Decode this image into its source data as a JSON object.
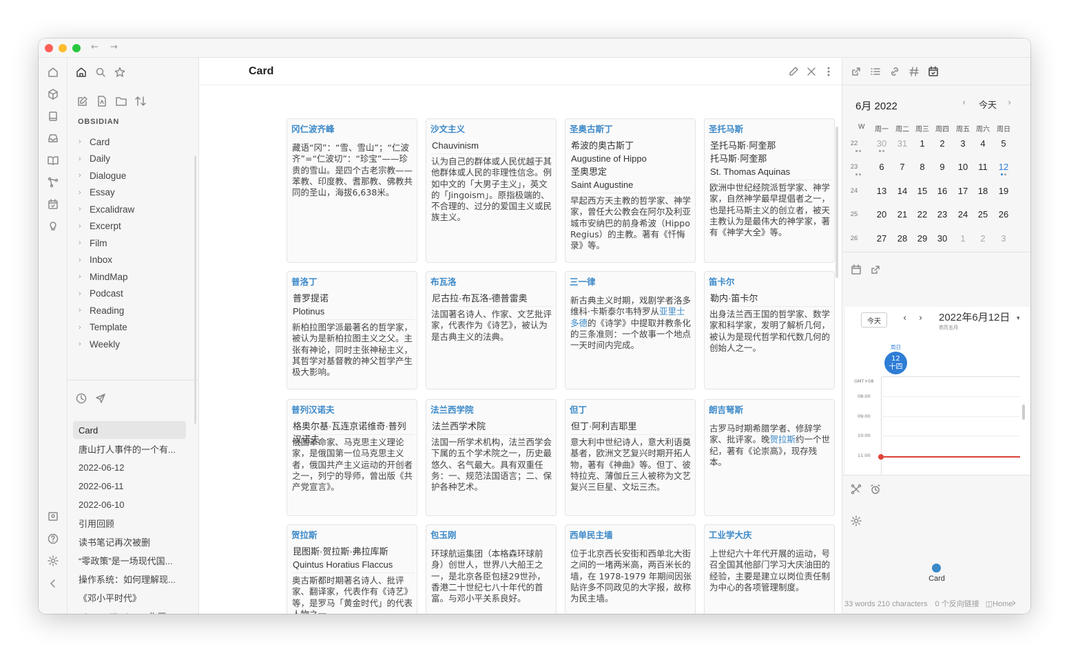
{
  "window": {
    "nav_back": "←",
    "nav_forward": "→"
  },
  "sidebar": {
    "vault_name": "OBSIDIAN",
    "folders": [
      "Card",
      "Daily",
      "Dialogue",
      "Essay",
      "Excalidraw",
      "Excerpt",
      "Film",
      "Inbox",
      "MindMap",
      "Podcast",
      "Reading",
      "Template",
      "Weekly"
    ],
    "recent": [
      "Card",
      "唐山打人事件的一个有...",
      "2022-06-12",
      "2022-06-11",
      "2022-06-10",
      "引用回顾",
      "读书笔记再次被删",
      "“零政策”是一场现代国...",
      "操作系统：如何理解现...",
      "《邓小平时代》",
      "Disco Diffusion AI作画..."
    ]
  },
  "main": {
    "title": "Card",
    "cards": [
      {
        "title": "冈仁波齐峰",
        "sub": [],
        "desc": "藏语“冈”：“雪、雪山”；“仁波齐”=“仁波切”：“珍宝”——珍贵的雪山。是四个古老宗教——苯教、印度教、耆那教、佛教共同的圣山，海拔6,638米。"
      },
      {
        "title": "沙文主义",
        "sub": [
          "Chauvinism"
        ],
        "desc": "认为自己的群体或人民优越于其他群体或人民的非理性信念。例如中文的「大男子主义」，英文的「Jingoism」。原指极端的、不合理的、过分的爱国主义或民族主义。"
      },
      {
        "title": "圣奥古斯丁",
        "sub": [
          "希波的奥古斯丁",
          "Augustine of Hippo",
          "圣奥思定",
          "Saint Augustine"
        ],
        "desc": "早起西方天主教的哲学家、神学家，曾任大公教会在阿尔及利亚城市安纳巴的前身希波（Hippo Regius）的主教。著有《忏悔录》等。"
      },
      {
        "title": "圣托马斯",
        "sub": [
          "圣托马斯·阿奎那",
          "托马斯·阿奎那",
          "St. Thomas Aquinas"
        ],
        "desc": "欧洲中世纪经院派哲学家、神学家，自然神学最早提倡者之一，也是托马斯主义的创立者，被天主教认为是最伟大的神学家，著有《神学大全》等。"
      },
      {
        "title": "普洛丁",
        "sub": [
          "普罗提诺",
          "Plotinus"
        ],
        "desc": "新柏拉图学派最著名的哲学家，被认为是新柏拉图主义之父。主张有神论，同时主张神秘主义，其哲学对基督教的神父哲学产生极大影响。"
      },
      {
        "title": "布瓦洛",
        "sub": [
          "尼古拉·布瓦洛-德普雷奥"
        ],
        "desc": "法国著名诗人、作家、文艺批评家，代表作为《诗艺》，被认为是古典主义的法典。"
      },
      {
        "title": "三一律",
        "sub": [],
        "desc_pre": "新古典主义时期，戏剧学者洛多维科·卡斯泰尔韦特罗从",
        "desc_link": "亚里士多德",
        "desc_post": "的《诗学》中提取并教条化的三条准则：一个故事一个地点一天时间内完成。"
      },
      {
        "title": "笛卡尔",
        "sub": [
          "勒内·笛卡尔"
        ],
        "desc": "出身法兰西王国的哲学家、数学家和科学家，发明了解析几何，被认为是现代哲学和代数几何的创始人之一。"
      },
      {
        "title": "普列汉诺夫",
        "sub": [
          "格奥尔基·瓦连京诺维奇·普列汉诺夫"
        ],
        "desc": "俄国革命家、马克思主义理论家，是俄国第一位马克思主义者，俄国共产主义运动的开创者之一，列宁的导师，曾出版《共产党宣言》。"
      },
      {
        "title": "法兰西学院",
        "sub": [
          "法兰西学术院"
        ],
        "desc": "法国一所学术机构，法兰西学会下属的五个学术院之一，历史最悠久、名气最大。具有双重任务：一、规范法国语言；二、保护各种艺术。"
      },
      {
        "title": "但丁",
        "sub": [
          "但丁·阿利吉耶里"
        ],
        "desc": "意大利中世纪诗人，意大利语奠基者，欧洲文艺复兴时期开拓人物，著有《神曲》等。但丁、彼特拉克、薄伽丘三人被称为文艺复兴三巨星、文坛三杰。"
      },
      {
        "title": "朗吉弩斯",
        "sub": [],
        "desc_pre": "古罗马时期希腊学者、修辞学家、批评家。晚",
        "desc_link": "贺拉斯",
        "desc_post": "约一个世纪，著有《论崇高》，现存残本。"
      },
      {
        "title": "贺拉斯",
        "sub": [
          "昆图斯·贺拉斯·弗拉库斯",
          "Quintus Horatius Flaccus"
        ],
        "desc": "奥古斯都时期著名诗人、批评家、翻译家，代表作有《诗艺》等，是罗马「黄金时代」的代表人物之一。"
      },
      {
        "title": "包玉刚",
        "sub": [],
        "desc": "环球航运集团（本格森环球前身）创世人，世界八大船王之一，是北京各臣包拯29世孙，香港二十世纪七八十年代的首富。与邓小平关系良好。"
      },
      {
        "title": "西单民主墙",
        "sub": [],
        "desc": "位于北京西长安街和西单北大街之间的一堵两米高，两百米长的墙，在 1978-1979 年期间因张贴许多不同政见的大字报，故称为民主墙。"
      },
      {
        "title": "工业学大庆",
        "sub": [],
        "desc": "上世纪六十年代开展的运动，号召全国其他部门学习大庆油田的经验，主要是建立以岗位责任制为中心的各项管理制度。"
      }
    ]
  },
  "calendar": {
    "month_title": "6月 2022",
    "today_label": "今天",
    "week_header": [
      "W",
      "周一",
      "周二",
      "周三",
      "周四",
      "周五",
      "周六",
      "周日"
    ],
    "weeks": [
      {
        "wk": "22",
        "days": [
          "30",
          "31",
          "1",
          "2",
          "3",
          "4",
          "5"
        ]
      },
      {
        "wk": "23",
        "days": [
          "6",
          "7",
          "8",
          "9",
          "10",
          "11",
          "12"
        ]
      },
      {
        "wk": "24",
        "days": [
          "13",
          "14",
          "15",
          "16",
          "17",
          "18",
          "19"
        ]
      },
      {
        "wk": "25",
        "days": [
          "20",
          "21",
          "22",
          "23",
          "24",
          "25",
          "26"
        ]
      },
      {
        "wk": "26",
        "days": [
          "27",
          "28",
          "29",
          "30",
          "1",
          "2",
          "3"
        ]
      }
    ]
  },
  "day_view": {
    "today_btn": "今天",
    "date_title": "2022年6月12日",
    "lunar": "农历五月",
    "weekday": "周日",
    "day_num": "12",
    "day_lunar": "十四",
    "tz": "GMT+08",
    "hours": [
      "08:00",
      "09:00",
      "10:00",
      "11:00"
    ]
  },
  "graph": {
    "node_label": "Card"
  },
  "status": {
    "words": "33 words 210 characters",
    "backlinks": "0 个反向链接",
    "home": "Home"
  },
  "colors": {
    "accent": "#3c89c8",
    "today": "#2e7dd6",
    "now_line": "#e0433c"
  }
}
